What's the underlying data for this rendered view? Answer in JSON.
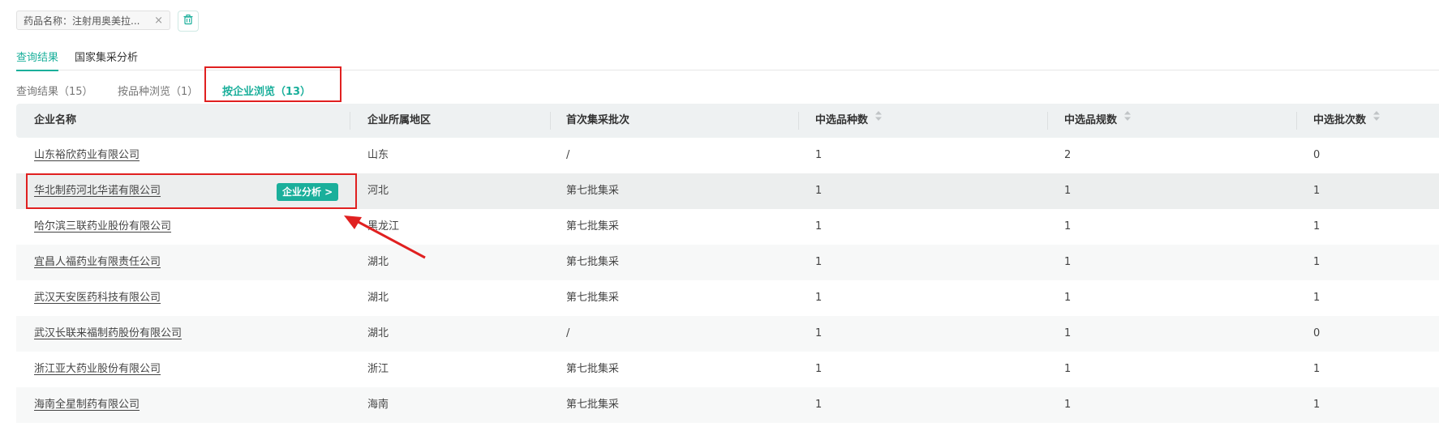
{
  "filter": {
    "chip_text": "药品名称：注射用奥美拉...",
    "close_glyph": "×"
  },
  "main_tabs": [
    {
      "label": "查询结果",
      "active": true
    },
    {
      "label": "国家集采分析",
      "active": false
    }
  ],
  "sub_tabs": [
    {
      "label": "查询结果（15）",
      "active": false
    },
    {
      "label": "按品种浏览（1）",
      "active": false
    },
    {
      "label": "按企业浏览（13）",
      "active": true
    }
  ],
  "table": {
    "headers": {
      "company": "企业名称",
      "region": "企业所属地区",
      "first_batch": "首次集采批次",
      "variety_count": "中选品种数",
      "spec_count": "中选品规数",
      "batch_count": "中选批次数"
    },
    "rows": [
      {
        "company": "山东裕欣药业有限公司",
        "region": "山东",
        "first_batch": "/",
        "variety_count": "1",
        "spec_count": "2",
        "batch_count": "0"
      },
      {
        "company": "华北制药河北华诺有限公司",
        "region": "河北",
        "first_batch": "第七批集采",
        "variety_count": "1",
        "spec_count": "1",
        "batch_count": "1",
        "action": "企业分析 >"
      },
      {
        "company": "哈尔滨三联药业股份有限公司",
        "region": "黑龙江",
        "first_batch": "第七批集采",
        "variety_count": "1",
        "spec_count": "1",
        "batch_count": "1"
      },
      {
        "company": "宜昌人福药业有限责任公司",
        "region": "湖北",
        "first_batch": "第七批集采",
        "variety_count": "1",
        "spec_count": "1",
        "batch_count": "1"
      },
      {
        "company": "武汉天安医药科技有限公司",
        "region": "湖北",
        "first_batch": "第七批集采",
        "variety_count": "1",
        "spec_count": "1",
        "batch_count": "1"
      },
      {
        "company": "武汉长联来福制药股份有限公司",
        "region": "湖北",
        "first_batch": "/",
        "variety_count": "1",
        "spec_count": "1",
        "batch_count": "0"
      },
      {
        "company": "浙江亚大药业股份有限公司",
        "region": "浙江",
        "first_batch": "第七批集采",
        "variety_count": "1",
        "spec_count": "1",
        "batch_count": "1"
      },
      {
        "company": "海南全星制药有限公司",
        "region": "海南",
        "first_batch": "第七批集采",
        "variety_count": "1",
        "spec_count": "1",
        "batch_count": "1"
      }
    ]
  },
  "colors": {
    "accent": "#1aaf9b",
    "annotation": "#e02020",
    "header_bg": "#eef1f2"
  },
  "icons": {
    "trash": "trash-icon",
    "sort": "sort-icon",
    "close": "close-icon"
  }
}
